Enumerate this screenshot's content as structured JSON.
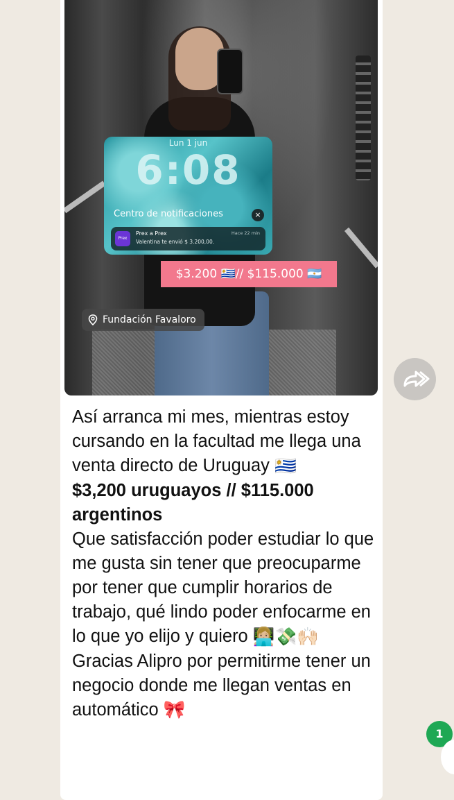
{
  "photo": {
    "lockscreen": {
      "date": "Lun 1 jun",
      "time": "6:08",
      "notification_center": "Centro de notificaciones",
      "close_glyph": "×",
      "notification": {
        "app_icon_text": "Prex",
        "title": "Prex a Prex",
        "body": "Valentina te envió $ 3.200,00.",
        "time": "Hace 22 min"
      }
    },
    "overlay_text": "$3.200 🇺🇾// $115.000 🇦🇷",
    "location": "Fundación Favaloro"
  },
  "message": {
    "line1": "Así arranca mi mes, mientras estoy cursando en la facultad me llega una venta directo de Uruguay",
    "line1_emoji": "🇺🇾",
    "bold_line": "$3,200 uruguayos // $115.000 argentinos",
    "line2": "Que satisfacción poder estudiar lo que me gusta sin tener que preocuparme por tener que cumplir horarios de trabajo, qué lindo poder enfocarme en lo que yo elijo y quiero",
    "line2_emojis": "👩🏼‍💻💸🙌🏻",
    "line3": "Gracias Alipro por permitirme tener un negocio donde me llegan ventas en automático",
    "line3_emoji": "🎀"
  },
  "unread_badge": "1",
  "colors": {
    "chat_bg": "#efeae2",
    "bubble": "#ffffff",
    "badge": "#1ea854",
    "pink_overlay": "#f2788d"
  }
}
